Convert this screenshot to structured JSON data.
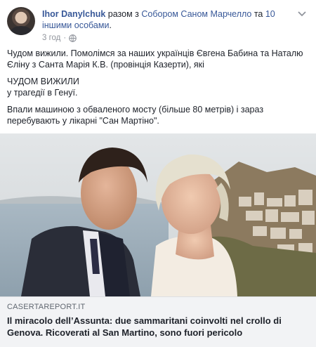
{
  "post": {
    "author": "Ihor Danylchuk",
    "with_text": " разом з ",
    "tagged_person": "Собором Саном Марчелло",
    "and_text": " та ",
    "others": "10 іншими особами",
    "period": ".",
    "time": "3 год",
    "dot": "·",
    "icons": {
      "privacy": "globe-icon",
      "options": "chevron-down-icon"
    }
  },
  "content": {
    "paragraph1": "Чудом вижили. Помолімся за наших українців Євгена Бабина та Наталю Єліну з Санта Марія К.В. (провінція Казерти), які",
    "line_caps": "ЧУДОМ ВИЖИЛИ",
    "line_genoa": "у трагедії в Генуї.",
    "paragraph3": "Впали машиною з обваленого мосту (більше 80 метрів) і зараз перебувають у лікарні \"Сан Мартіно\"."
  },
  "link_preview": {
    "domain": "CASERTAREPORT.IT",
    "title": "Il miracolo dell’Assunta: due sammaritani coinvolti nel crollo di Genova. Ricoverati al San Martino, sono fuori pericolo"
  }
}
